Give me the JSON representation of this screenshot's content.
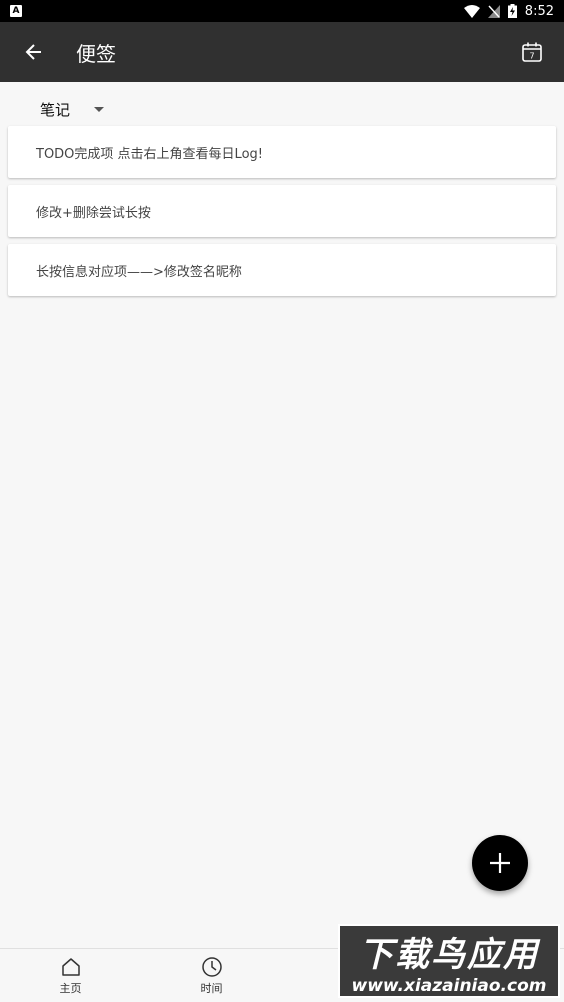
{
  "status_bar": {
    "left_badge": "A",
    "time": "8:52"
  },
  "app_bar": {
    "title": "便签"
  },
  "filter": {
    "selected": "笔记"
  },
  "notes": [
    {
      "text": "TODO完成项 点击右上角查看每日Log!"
    },
    {
      "text": "修改+删除尝试长按"
    },
    {
      "text": "长按信息对应项——>修改签名昵称"
    }
  ],
  "calendar_day": "7",
  "bottom_nav": {
    "items": [
      {
        "label": "主页",
        "icon": "home-icon"
      },
      {
        "label": "时间",
        "icon": "clock-icon"
      },
      {
        "label": "",
        "icon": "note-icon"
      },
      {
        "label": "",
        "icon": "check-icon"
      }
    ]
  },
  "watermark": {
    "title": "下载鸟应用",
    "url": "www.xiazainiao.com"
  },
  "colors": {
    "app_bar": "#303030",
    "fab": "#000000",
    "background": "#f7f7f7"
  }
}
